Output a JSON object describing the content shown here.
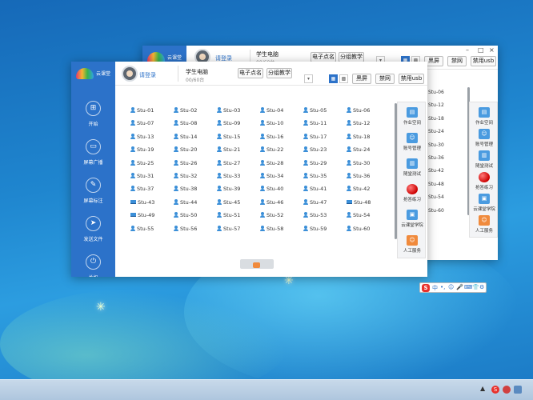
{
  "app": {
    "logo_text": "云课堂",
    "login_text": "请登录",
    "pc_label": "学生电脑",
    "pc_count": "00/60台",
    "buttons": {
      "rename": "电子点名",
      "group": "分组教学",
      "black_screen": "黑屏",
      "disable_net": "禁网",
      "disable_usb": "禁用usb"
    },
    "view_icons": [
      "list-view-icon",
      "grid-view-icon",
      "large-grid-view-icon"
    ]
  },
  "back_window": {
    "pc_count": "00/60台",
    "edge_students": [
      "Stu-06",
      "Stu-12",
      "Stu-18",
      "Stu-24",
      "Stu-30",
      "Stu-36",
      "Stu-42",
      "Stu-48",
      "Stu-54",
      "Stu-60"
    ],
    "win_controls": [
      "–",
      "□",
      "×"
    ]
  },
  "sidebar": {
    "items": [
      {
        "label": "开始",
        "icon": "windows-icon"
      },
      {
        "label": "屏幕广播",
        "icon": "monitor-icon"
      },
      {
        "label": "屏幕标注",
        "icon": "pen-icon"
      },
      {
        "label": "发送文件",
        "icon": "send-icon"
      },
      {
        "label": "关机",
        "icon": "power-icon"
      }
    ]
  },
  "students": {
    "rows": [
      [
        "Stu-01",
        "Stu-02",
        "Stu-03",
        "Stu-04",
        "Stu-05",
        "Stu-06"
      ],
      [
        "Stu-07",
        "Stu-08",
        "Stu-09",
        "Stu-10",
        "Stu-11",
        "Stu-12"
      ],
      [
        "Stu-13",
        "Stu-14",
        "Stu-15",
        "Stu-16",
        "Stu-17",
        "Stu-18"
      ],
      [
        "Stu-19",
        "Stu-20",
        "Stu-21",
        "Stu-22",
        "Stu-23",
        "Stu-24"
      ],
      [
        "Stu-25",
        "Stu-26",
        "Stu-27",
        "Stu-28",
        "Stu-29",
        "Stu-30"
      ],
      [
        "Stu-31",
        "Stu-32",
        "Stu-33",
        "Stu-34",
        "Stu-35",
        "Stu-36"
      ],
      [
        "Stu-37",
        "Stu-38",
        "Stu-39",
        "Stu-40",
        "Stu-41",
        "Stu-42"
      ],
      [
        "Stu-43",
        "Stu-44",
        "Stu-45",
        "Stu-46",
        "Stu-47",
        "Stu-48"
      ],
      [
        "Stu-49",
        "Stu-50",
        "Stu-51",
        "Stu-52",
        "Stu-53",
        "Stu-54"
      ],
      [
        "Stu-55",
        "Stu-56",
        "Stu-57",
        "Stu-58",
        "Stu-59",
        "Stu-60"
      ]
    ],
    "monitor_icon_students": [
      "Stu-43",
      "Stu-48",
      "Stu-49"
    ]
  },
  "right_panel": {
    "items": [
      {
        "label": "作业空间",
        "icon": "folder-icon"
      },
      {
        "label": "账号管理",
        "icon": "user-icon"
      },
      {
        "label": "随堂测试",
        "icon": "test-icon"
      },
      {
        "label": "抢答练习",
        "icon": "red-ball-icon"
      },
      {
        "label": "云课堂学院",
        "icon": "college-icon"
      },
      {
        "label": "人工服务",
        "icon": "service-icon"
      }
    ]
  },
  "ime": {
    "items": [
      "S",
      "中",
      "•,",
      "☺",
      "🎤",
      "⌨",
      "👕",
      "⚙"
    ]
  },
  "taskbar": {
    "tray_items": [
      "▲",
      "S"
    ]
  }
}
